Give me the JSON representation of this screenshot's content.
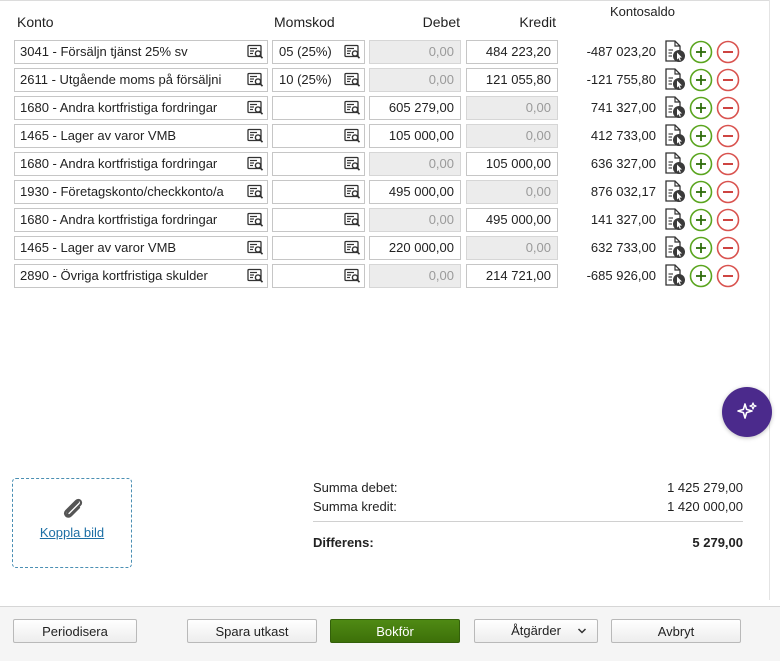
{
  "columns": {
    "konto": "Konto",
    "momskod": "Momskod",
    "debet": "Debet",
    "kredit": "Kredit",
    "kontosaldo": "Kontosaldo"
  },
  "rows": [
    {
      "account": "3041 - Försäljn tjänst 25% sv",
      "vat": "05 (25%)",
      "debet": "0,00",
      "kredit": "484 223,20",
      "saldo": "-487 023,20",
      "debet_disabled": true,
      "kredit_disabled": false
    },
    {
      "account": "2611 - Utgående moms på försäljni",
      "vat": "10 (25%)",
      "debet": "0,00",
      "kredit": "121 055,80",
      "saldo": "-121 755,80",
      "debet_disabled": true,
      "kredit_disabled": false
    },
    {
      "account": "1680 - Andra kortfristiga fordringar",
      "vat": "",
      "debet": "605 279,00",
      "kredit": "0,00",
      "saldo": "741 327,00",
      "debet_disabled": false,
      "kredit_disabled": true
    },
    {
      "account": "1465 - Lager av varor VMB",
      "vat": "",
      "debet": "105 000,00",
      "kredit": "0,00",
      "saldo": "412 733,00",
      "debet_disabled": false,
      "kredit_disabled": true
    },
    {
      "account": "1680 - Andra kortfristiga fordringar",
      "vat": "",
      "debet": "0,00",
      "kredit": "105 000,00",
      "saldo": "636 327,00",
      "debet_disabled": true,
      "kredit_disabled": false
    },
    {
      "account": "1930 - Företagskonto/checkkonto/a",
      "vat": "",
      "debet": "495 000,00",
      "kredit": "0,00",
      "saldo": "876 032,17",
      "debet_disabled": false,
      "kredit_disabled": true
    },
    {
      "account": "1680 - Andra kortfristiga fordringar",
      "vat": "",
      "debet": "0,00",
      "kredit": "495 000,00",
      "saldo": "141 327,00",
      "debet_disabled": true,
      "kredit_disabled": false
    },
    {
      "account": "1465 - Lager av varor VMB",
      "vat": "",
      "debet": "220 000,00",
      "kredit": "0,00",
      "saldo": "632 733,00",
      "debet_disabled": false,
      "kredit_disabled": true
    },
    {
      "account": "2890 - Övriga kortfristiga skulder",
      "vat": "",
      "debet": "0,00",
      "kredit": "214 721,00",
      "saldo": "-685 926,00",
      "debet_disabled": true,
      "kredit_disabled": false
    }
  ],
  "attachment": {
    "label": "Koppla bild"
  },
  "summary": {
    "debet_label": "Summa debet:",
    "debet_value": "1 425 279,00",
    "kredit_label": "Summa kredit:",
    "kredit_value": "1 420 000,00",
    "diff_label": "Differens:",
    "diff_value": "5 279,00"
  },
  "footer": {
    "periodisera": "Periodisera",
    "spara_utkast": "Spara utkast",
    "bokfor": "Bokför",
    "atgarder": "Åtgärder",
    "avbryt": "Avbryt"
  },
  "colors": {
    "primary_green": "#4f8a14",
    "add_green": "#5aa51e",
    "remove_red": "#d9534f",
    "ai_purple": "#4b2a8c",
    "link_blue": "#1d6fa5"
  },
  "icons": {
    "lookup": "search-list-icon",
    "doc": "document-cursor-icon",
    "add": "plus-circle-icon",
    "remove": "minus-circle-icon",
    "ai": "sparkle-icon",
    "attach": "paperclip-icon",
    "dropdown": "chevron-down-icon"
  }
}
